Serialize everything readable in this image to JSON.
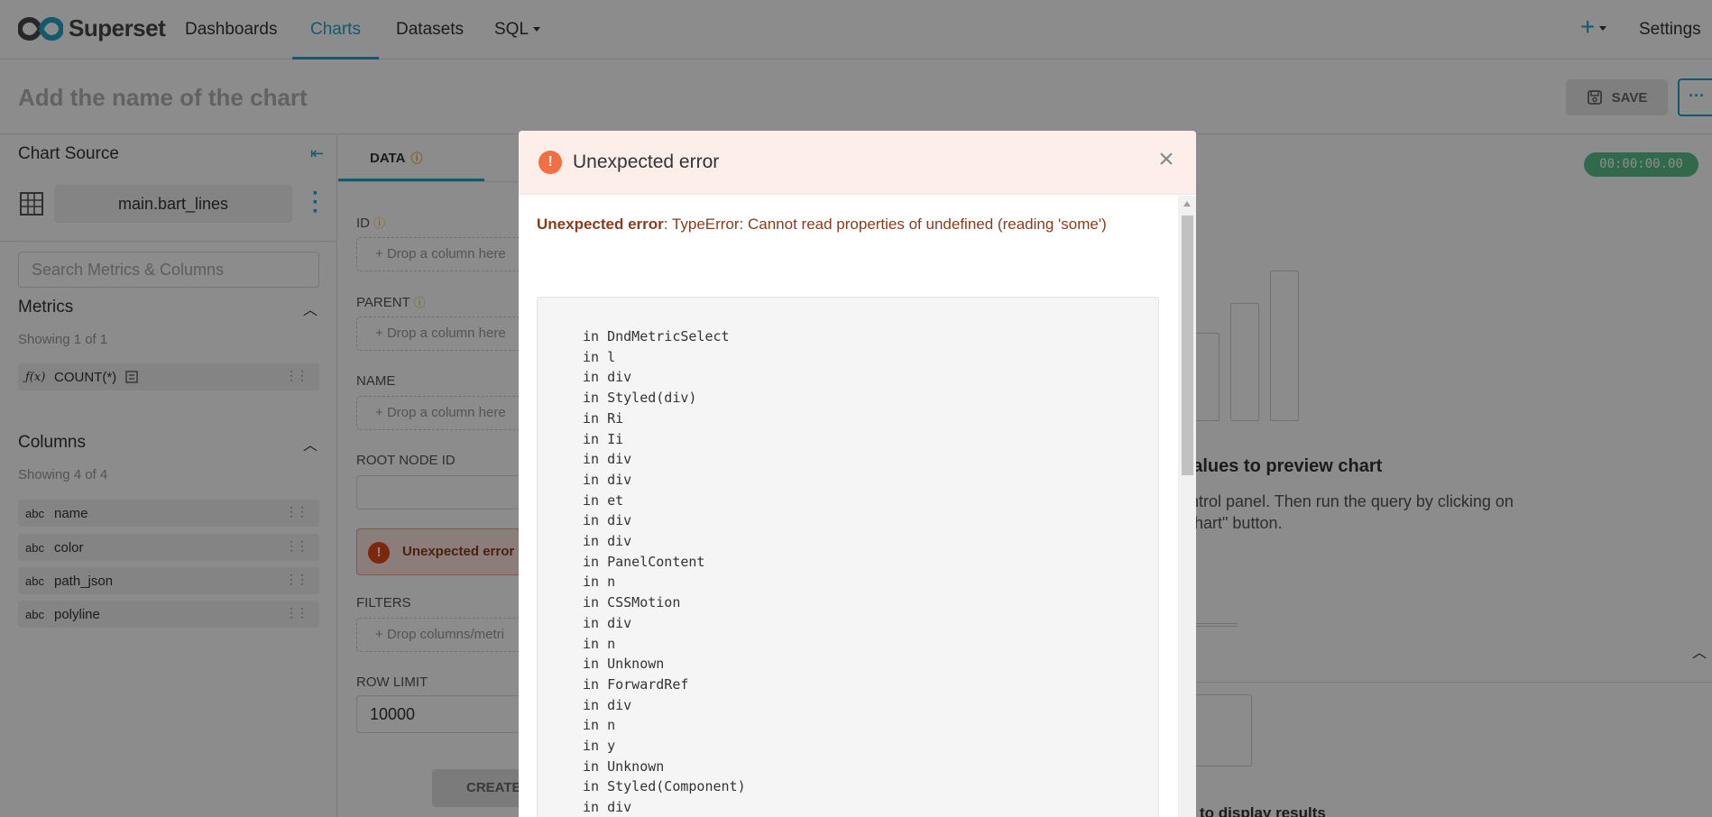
{
  "header": {
    "logo_text": "Superset",
    "nav": [
      "Dashboards",
      "Charts",
      "Datasets",
      "SQL"
    ],
    "plus": "+",
    "settings": "Settings"
  },
  "titlebar": {
    "chart_name_placeholder": "Add the name of the chart",
    "save_label": "SAVE",
    "more_label": "···"
  },
  "left_panel": {
    "title": "Chart Source",
    "dataset": "main.bart_lines",
    "search_placeholder": "Search Metrics & Columns",
    "metrics": {
      "title": "Metrics",
      "count": "Showing 1 of 1",
      "items": [
        {
          "type": "ƒ(x)",
          "name": "COUNT(*)"
        }
      ]
    },
    "columns": {
      "title": "Columns",
      "count": "Showing 4 of 4",
      "items": [
        {
          "type": "abc",
          "name": "name"
        },
        {
          "type": "abc",
          "name": "color"
        },
        {
          "type": "abc",
          "name": "path_json"
        },
        {
          "type": "abc",
          "name": "polyline"
        }
      ]
    }
  },
  "middle_panel": {
    "tab": "DATA",
    "fields": {
      "id": {
        "label": "ID",
        "drop": "Drop a column here"
      },
      "parent": {
        "label": "PARENT",
        "drop": "Drop a column here"
      },
      "name": {
        "label": "NAME",
        "drop": "Drop a column here"
      },
      "root": {
        "label": "ROOT NODE ID"
      },
      "filters": {
        "label": "FILTERS",
        "drop": "Drop columns/metri"
      },
      "row_limit": {
        "label": "ROW LIMIT",
        "value": "10000"
      }
    },
    "error_banner": "Unexpected error",
    "create_label": "CREATE"
  },
  "right_panel": {
    "timer": "00:00:00.00",
    "preview_title": "l values to preview chart",
    "preview_desc": "control panel. Then run the query by clicking on\ne chart\" button.",
    "bottom_text": "to display results"
  },
  "modal": {
    "title": "Unexpected error",
    "error_label": "Unexpected error",
    "error_message": ": TypeError: Cannot read properties of undefined (reading 'some')",
    "stack": [
      "in DndMetricSelect",
      "in l",
      "in div",
      "in Styled(div)",
      "in Ri",
      "in Ii",
      "in div",
      "in div",
      "in et",
      "in div",
      "in div",
      "in PanelContent",
      "in n",
      "in CSSMotion",
      "in div",
      "in n",
      "in Unknown",
      "in ForwardRef",
      "in div",
      "in n",
      "in y",
      "in Unknown",
      "in Styled(Component)",
      "in div"
    ]
  },
  "colors": {
    "accent": "#20a7c9",
    "error": "#f36f43",
    "success": "#5ac189"
  }
}
